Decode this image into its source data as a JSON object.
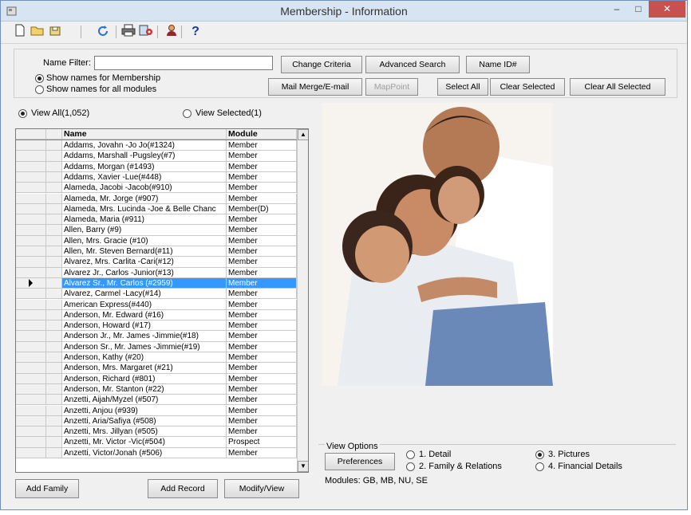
{
  "window": {
    "title": "Membership - Information",
    "icon": "app-icon",
    "controls": {
      "minimize": "–",
      "maximize": "□",
      "close": "✕"
    }
  },
  "toolbar": {
    "icons": [
      "new-document-icon",
      "open-folder-icon",
      "save-icon",
      "refresh-icon",
      "print-icon",
      "settings-icon",
      "user-icon",
      "help-icon"
    ],
    "help_glyph": "?"
  },
  "filter": {
    "name_filter_label": "Name Filter:",
    "name_filter_value": "",
    "radio_membership": "Show names for Membership",
    "radio_all_modules": "Show names for all modules",
    "membership_selected": true
  },
  "buttons": {
    "change_criteria": "Change Criteria",
    "advanced_search": "Advanced Search",
    "name_id": "Name ID#",
    "mail_merge": "Mail Merge/E-mail",
    "mappoint": "MapPoint",
    "select_all": "Select All",
    "clear_selected": "Clear Selected",
    "clear_all_selected": "Clear All Selected",
    "add_family": "Add Family",
    "add_record": "Add Record",
    "modify_view": "Modify/View",
    "preferences": "Preferences"
  },
  "view_toggle": {
    "view_all": "View All(1,052)",
    "view_selected": "View Selected(1)",
    "view_all_selected": true
  },
  "grid": {
    "columns": [
      "Name",
      "Module"
    ],
    "selected_index": 15,
    "rows": [
      {
        "name": "Addams, Jovahn -Jo Jo(#1324)",
        "module": "Member"
      },
      {
        "name": "Addams, Marshall -Pugsley(#7)",
        "module": "Member"
      },
      {
        "name": "Addams, Morgan (#1493)",
        "module": "Member"
      },
      {
        "name": "Addams, Xavier -Lue(#448)",
        "module": "Member"
      },
      {
        "name": "Alameda, Jacobi -Jacob(#910)",
        "module": "Member"
      },
      {
        "name": "Alameda, Mr. Jorge (#907)",
        "module": "Member"
      },
      {
        "name": "Alameda, Mrs. Lucinda -Joe  & Belle Chanc",
        "module": "Member(D)"
      },
      {
        "name": "Alameda, Maria (#911)",
        "module": "Member"
      },
      {
        "name": "Allen, Barry (#9)",
        "module": "Member"
      },
      {
        "name": "Allen, Mrs. Gracie (#10)",
        "module": "Member"
      },
      {
        "name": "Allen, Mr. Steven Bernard(#11)",
        "module": "Member"
      },
      {
        "name": "Alvarez, Mrs. Carlita -Cari(#12)",
        "module": "Member"
      },
      {
        "name": "Alvarez Jr., Carlos -Junior(#13)",
        "module": "Member"
      },
      {
        "name": "Alvarez Sr., Mr. Carlos (#2959)",
        "module": "Member"
      },
      {
        "name": "Alvarez, Carmel -Lacy(#14)",
        "module": "Member"
      },
      {
        "name": "American Express(#440)",
        "module": "Member"
      },
      {
        "name": "Anderson, Mr. Edward (#16)",
        "module": "Member"
      },
      {
        "name": "Anderson, Howard (#17)",
        "module": "Member"
      },
      {
        "name": "Anderson Jr., Mr. James -Jimmie(#18)",
        "module": "Member"
      },
      {
        "name": "Anderson Sr., Mr. James -Jimmie(#19)",
        "module": "Member"
      },
      {
        "name": "Anderson, Kathy (#20)",
        "module": "Member"
      },
      {
        "name": "Anderson, Mrs. Margaret (#21)",
        "module": "Member"
      },
      {
        "name": "Anderson, Richard (#801)",
        "module": "Member"
      },
      {
        "name": "Anderson, Mr. Stanton (#22)",
        "module": "Member"
      },
      {
        "name": "Anzetti, Aijah/Myzel (#507)",
        "module": "Member"
      },
      {
        "name": "Anzetti, Anjou (#939)",
        "module": "Member"
      },
      {
        "name": "Anzetti, Aria/Safiya (#508)",
        "module": "Member"
      },
      {
        "name": "Anzetti, Mrs. Jillyan (#505)",
        "module": "Member"
      },
      {
        "name": "Anzetti, Mr. Victor -Vic(#504)",
        "module": "Prospect"
      },
      {
        "name": "Anzetti, Victor/Jonah (#506)",
        "module": "Member"
      }
    ]
  },
  "view_options": {
    "group_label": "View Options",
    "opt_detail": "1. Detail",
    "opt_family": "2. Family & Relations",
    "opt_pictures": "3. Pictures",
    "opt_financial": "4. Financial Details",
    "selected": "pictures",
    "modules_text": "Modules: GB, MB, NU, SE"
  },
  "colors": {
    "selection": "#3399ff",
    "titlebar": "#d7e4f2",
    "close": "#c75050"
  }
}
